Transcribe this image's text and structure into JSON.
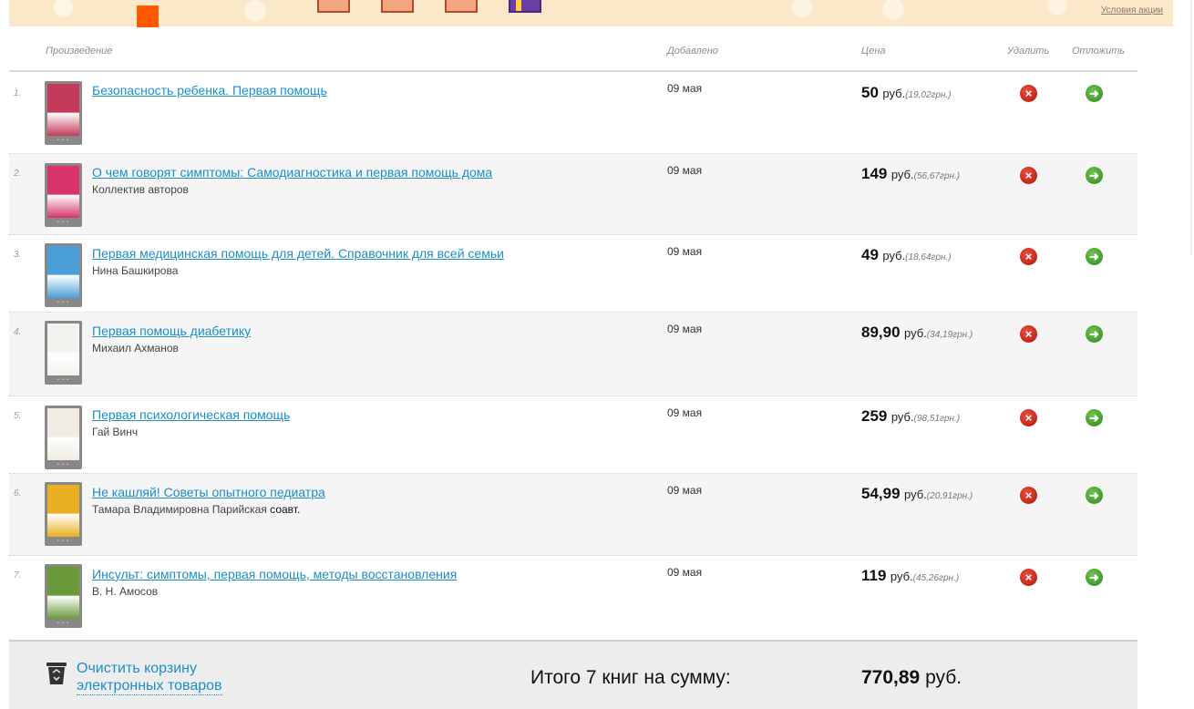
{
  "banner": {
    "conditions_link": "Условия акции",
    "accent_color": "#ff5a00",
    "background_color": "#fbe8c9"
  },
  "table_header": {
    "work": "Произведение",
    "added": "Добавлено",
    "price": "Цена",
    "delete": "Удалить",
    "defer": "Отложить"
  },
  "currency": "руб.",
  "rows": [
    {
      "num": "1.",
      "title": "Безопасность ребенка. Первая помощь",
      "author": "",
      "author_suffix": "",
      "date": "09 мая",
      "price": "50",
      "uah": "(19,02грн.)",
      "cover_color": "#c43a5a"
    },
    {
      "num": "2.",
      "title": "О чем говорят симптомы: Самодиагностика и первая помощь дома",
      "author": "Коллектив авторов",
      "author_suffix": "",
      "date": "09 мая",
      "price": "149",
      "uah": "(56,67грн.)",
      "cover_color": "#d8336b"
    },
    {
      "num": "3.",
      "title": "Первая медицинская помощь для детей. Справочник для всей семьи",
      "author": "Нина Башкирова",
      "author_suffix": "",
      "date": "09 мая",
      "price": "49",
      "uah": "(18,64грн.)",
      "cover_color": "#4a9fd8"
    },
    {
      "num": "4.",
      "title": "Первая помощь диабетику",
      "author": "Михаил Ахманов",
      "author_suffix": "",
      "date": "09 мая",
      "price": "89,90",
      "uah": "(34,19грн.)",
      "cover_color": "#f2f2ee"
    },
    {
      "num": "5.",
      "title": "Первая психологическая помощь",
      "author": "Гай Винч",
      "author_suffix": "",
      "date": "09 мая",
      "price": "259",
      "uah": "(98,51грн.)",
      "cover_color": "#f0ebe3"
    },
    {
      "num": "6.",
      "title": "Не кашляй! Советы опытного педиатра",
      "author": "Тамара Владимировна Парийская",
      "author_suffix": " соавт.",
      "date": "09 мая",
      "price": "54,99",
      "uah": "(20,91грн.)",
      "cover_color": "#e8b020"
    },
    {
      "num": "7.",
      "title": "Инсульт: симптомы, первая помощь, методы восстановления",
      "author": "В. Н. Амосов",
      "author_suffix": "",
      "date": "09 мая",
      "price": "119",
      "uah": "(45,26грн.)",
      "cover_color": "#6a9a3a"
    }
  ],
  "footer": {
    "clear_line1": "Очистить корзину",
    "clear_line2": "электронных товаров",
    "total_label": "Итого 7 книг на сумму:",
    "total_amount": "770,89",
    "total_currency": "руб."
  },
  "icons": {
    "delete": "delete-icon",
    "defer": "defer-icon",
    "trash": "trash-icon"
  }
}
